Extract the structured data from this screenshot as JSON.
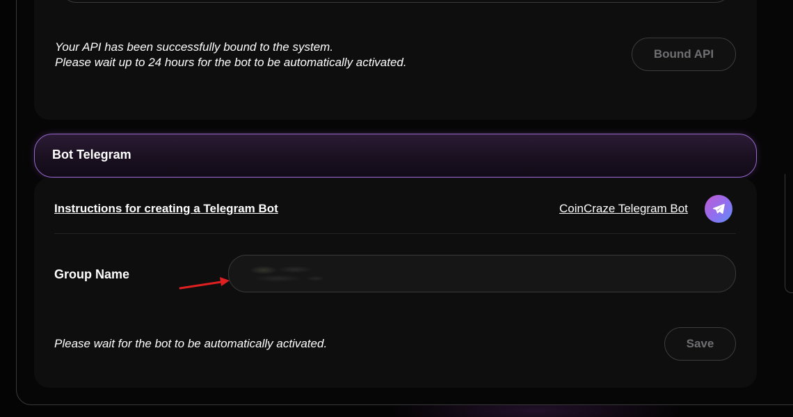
{
  "api_section": {
    "message_line1": "Your API has been successfully bound to the system.",
    "message_line2": "Please wait up to 24 hours for the bot to be automatically activated.",
    "bound_button_label": "Bound API"
  },
  "telegram_section": {
    "title": "Bot Telegram",
    "instructions_link": "Instructions for creating a Telegram Bot",
    "bot_link": "CoinCraze Telegram Bot",
    "bot_link_icon": "telegram-icon",
    "group_name_label": "Group Name",
    "group_name_value": "",
    "message": "Please wait for the bot to be automatically activated.",
    "save_button_label": "Save"
  },
  "colors": {
    "accent_border": "#9a6ad0",
    "annotation_arrow": "#e02020",
    "disabled_text": "#6f6f72"
  }
}
